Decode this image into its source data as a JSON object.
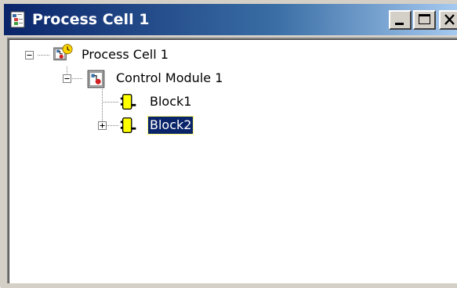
{
  "window": {
    "title": "Process Cell 1",
    "icon": "tree-window-icon",
    "buttons": {
      "minimize": "minimize-icon",
      "maximize": "maximize-icon",
      "close": "close-icon"
    }
  },
  "tree": {
    "nodes": [
      {
        "label": "Process Cell 1",
        "icon": "process-cell-icon",
        "expanded": true,
        "selected": false
      },
      {
        "label": "Control Module 1",
        "icon": "control-module-icon",
        "expanded": true,
        "selected": false
      },
      {
        "label": "Block1",
        "icon": "block-icon",
        "expanded": false,
        "selected": false
      },
      {
        "label": "Block2",
        "icon": "block-icon",
        "expanded": false,
        "selected": true
      }
    ]
  },
  "colors": {
    "title_gradient_start": "#0a246a",
    "title_gradient_end": "#a6caf0",
    "selection": "#0a246a",
    "block_yellow": "#ffff00",
    "face": "#d4d0c8"
  }
}
